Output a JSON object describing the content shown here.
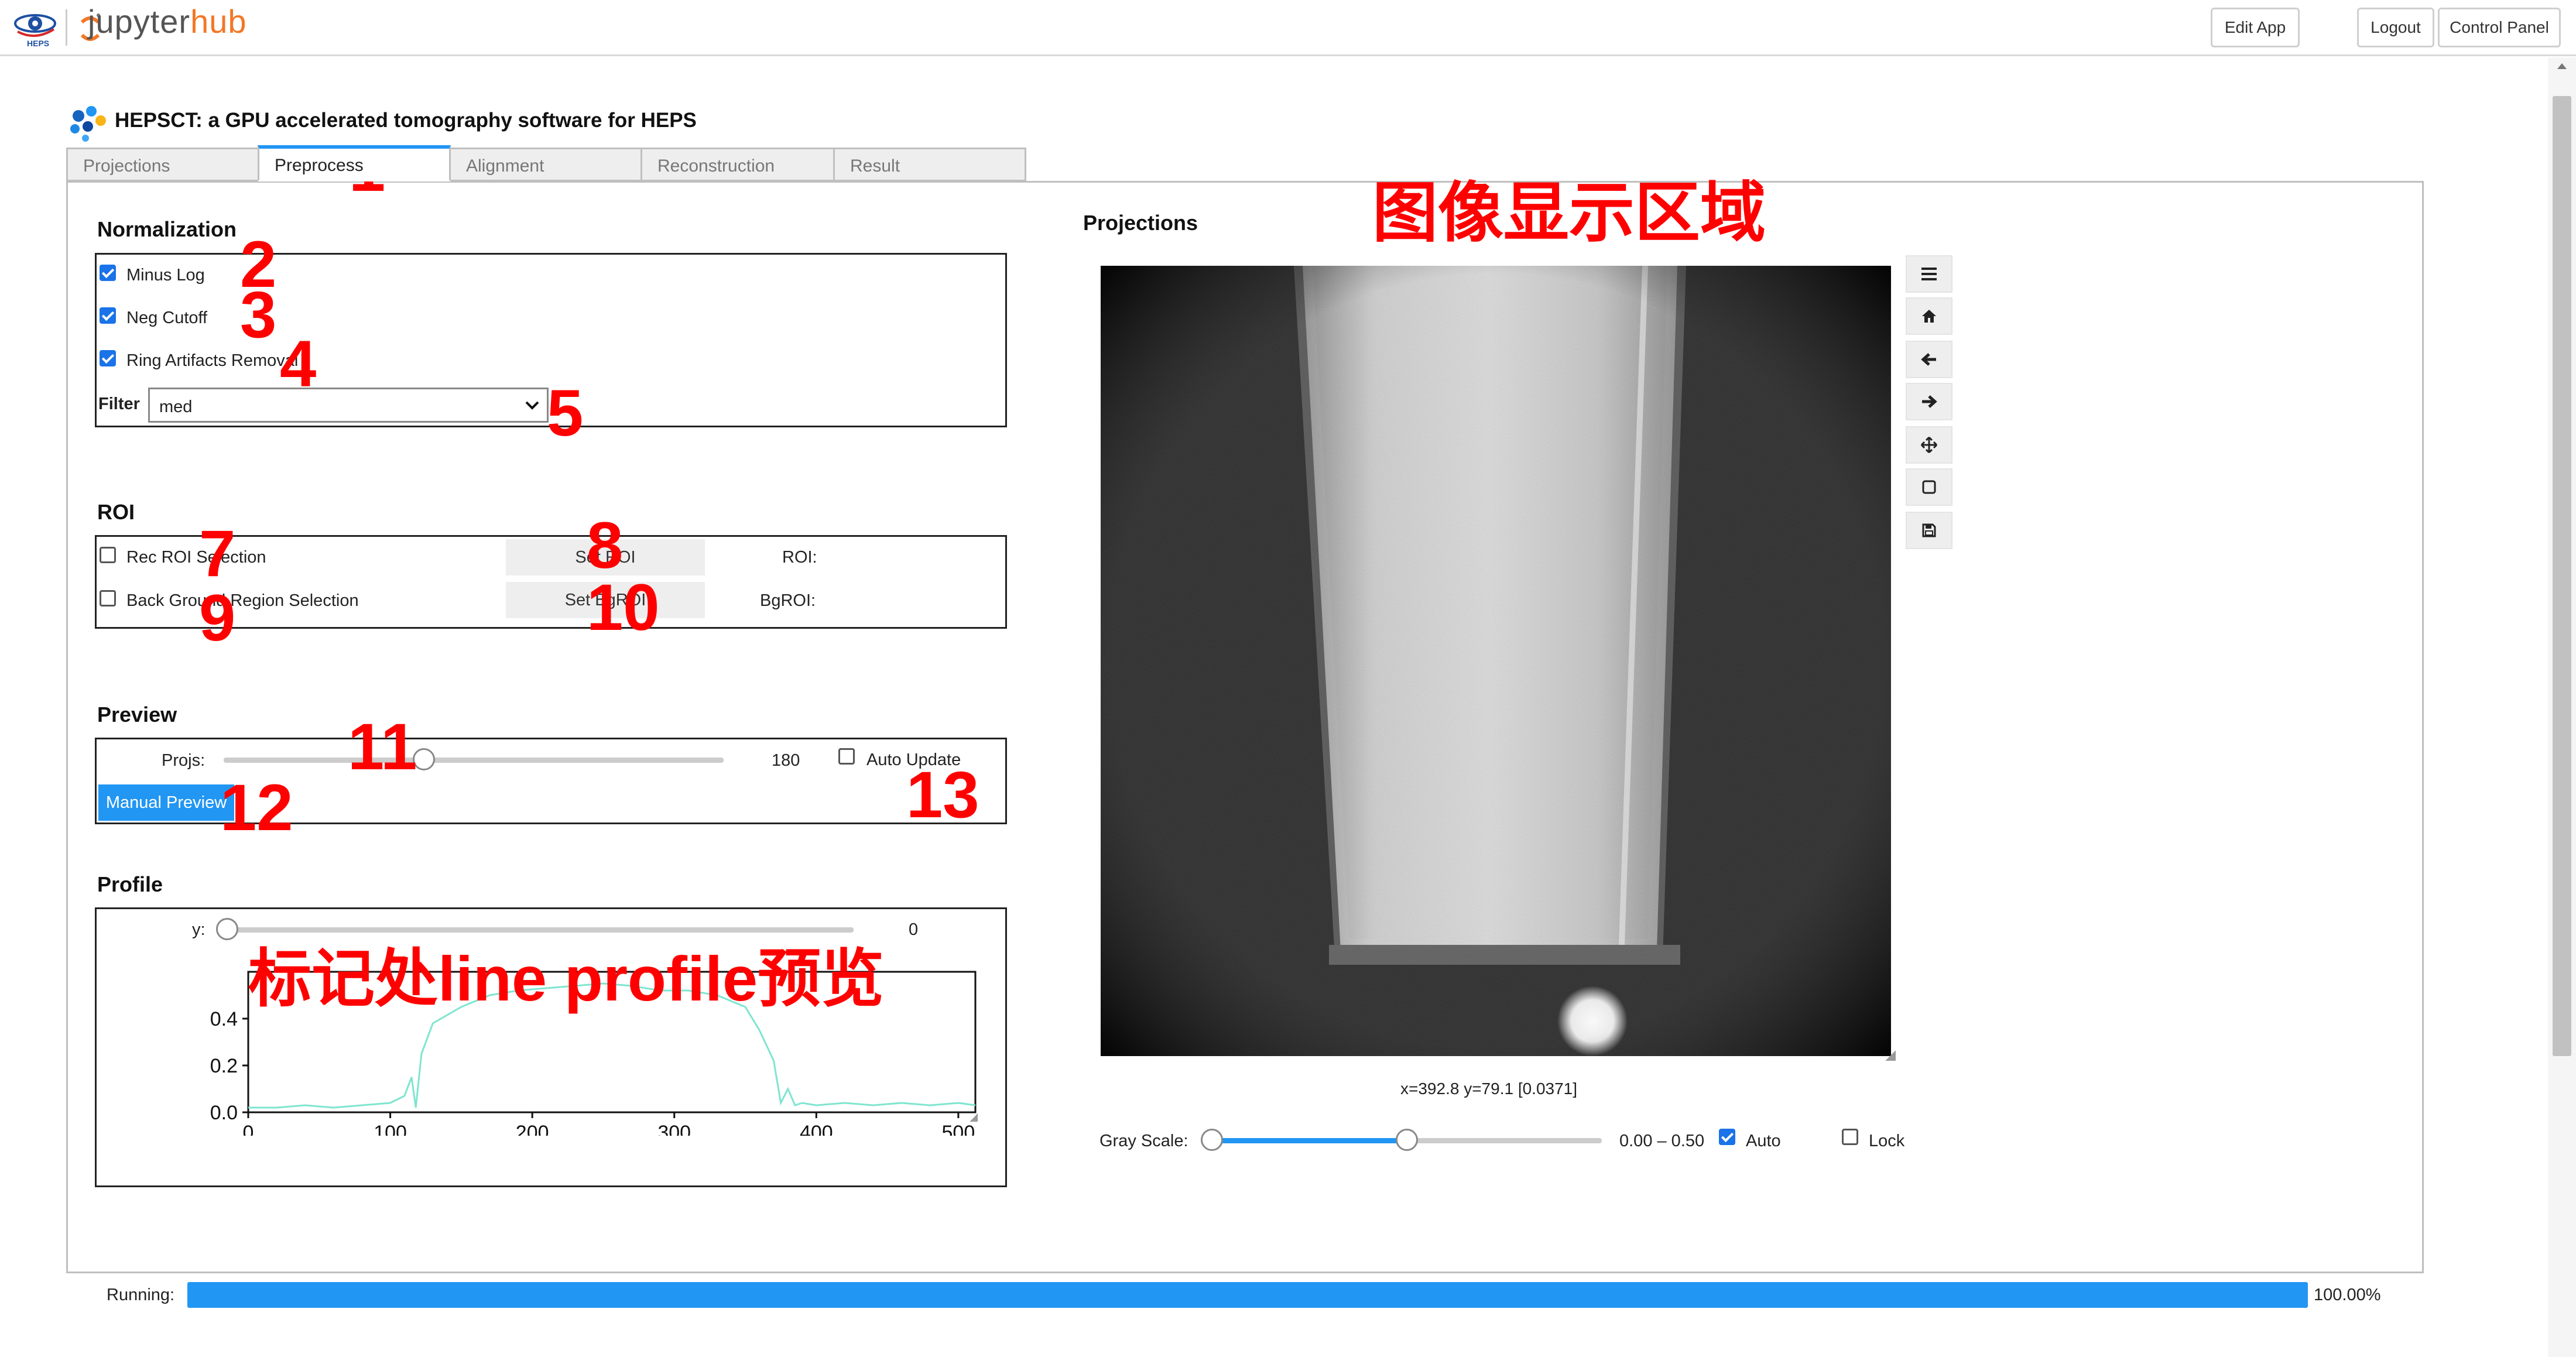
{
  "topbar": {
    "brand_small": "HEPS",
    "brand_word_a": "jupyter",
    "brand_word_b": "hub",
    "edit_app": "Edit App",
    "logout": "Logout",
    "control_panel": "Control Panel"
  },
  "app": {
    "title": "HEPSCT: a GPU accelerated tomography software for HEPS"
  },
  "tabs": [
    {
      "label": "Projections",
      "active": false
    },
    {
      "label": "Preprocess",
      "active": true
    },
    {
      "label": "Alignment",
      "active": false
    },
    {
      "label": "Reconstruction",
      "active": false
    },
    {
      "label": "Result",
      "active": false
    }
  ],
  "normalization": {
    "title": "Normalization",
    "minus_log": {
      "label": "Minus Log",
      "checked": true
    },
    "neg_cutoff": {
      "label": "Neg Cutoff",
      "checked": true
    },
    "ring_removal": {
      "label": "Ring Artifacts Removal",
      "checked": true
    },
    "filter_label": "Filter",
    "filter_value": "med"
  },
  "roi": {
    "title": "ROI",
    "rec_roi": {
      "label": "Rec ROI Selection",
      "checked": false
    },
    "bg_region": {
      "label": "Back Ground Region Selection",
      "checked": false
    },
    "set_roi": "Set ROI",
    "set_bgroi": "Set BgROI",
    "roi_label": "ROI:",
    "bgroi_label": "BgROI:"
  },
  "preview": {
    "title": "Preview",
    "projs_label": "Projs:",
    "projs_value": "180",
    "projs_fraction": 0.4,
    "auto_update": {
      "label": "Auto Update",
      "checked": false
    },
    "manual_preview": "Manual Preview"
  },
  "profile": {
    "title": "Profile",
    "y_label": "y:",
    "y_value": "0",
    "y_fraction": 0.0
  },
  "projections": {
    "title": "Projections",
    "coords": "x=392.8 y=79.1 [0.0371]",
    "gray_label": "Gray Scale:",
    "gray_range": "0.00 – 0.50",
    "gray_low_fraction": 0.0,
    "gray_high_fraction": 0.5,
    "auto": {
      "label": "Auto",
      "checked": true
    },
    "lock": {
      "label": "Lock",
      "checked": false
    },
    "toolbar_icons": [
      "menu-icon",
      "home-icon",
      "back-arrow-icon",
      "forward-arrow-icon",
      "pan-icon",
      "zoom-rect-icon",
      "save-icon"
    ]
  },
  "status": {
    "running_label": "Running:",
    "percent": "100.00%",
    "fraction": 1.0
  },
  "annotations": {
    "n1": "1",
    "n2": "2",
    "n3": "3",
    "n4": "4",
    "n5": "5",
    "n7": "7",
    "n8": "8",
    "n9": "9",
    "n10": "10",
    "n11": "11",
    "n12": "12",
    "n13": "13",
    "image_area": "图像显示区域",
    "profile_area": "标记处line profile预览"
  },
  "chart_data": {
    "type": "line",
    "title": "",
    "xlabel": "",
    "ylabel": "",
    "xlim": [
      0,
      512
    ],
    "ylim": [
      0,
      0.6
    ],
    "xticks": [
      "0",
      "100",
      "200",
      "300",
      "400",
      "500"
    ],
    "yticks": [
      "0.0",
      "0.2",
      "0.4"
    ],
    "grid": false,
    "series": [
      {
        "color": "#7fe5d0",
        "x": [
          0,
          20,
          40,
          60,
          80,
          100,
          110,
          115,
          118,
          122,
          130,
          150,
          170,
          190,
          210,
          230,
          250,
          270,
          290,
          310,
          330,
          350,
          360,
          370,
          375,
          380,
          385,
          390,
          400,
          420,
          440,
          460,
          480,
          500,
          512
        ],
        "y": [
          0.02,
          0.02,
          0.03,
          0.02,
          0.03,
          0.04,
          0.07,
          0.15,
          0.02,
          0.25,
          0.38,
          0.45,
          0.5,
          0.52,
          0.53,
          0.54,
          0.55,
          0.54,
          0.52,
          0.52,
          0.5,
          0.45,
          0.35,
          0.22,
          0.04,
          0.1,
          0.03,
          0.04,
          0.03,
          0.04,
          0.03,
          0.04,
          0.03,
          0.04,
          0.03
        ]
      }
    ]
  }
}
